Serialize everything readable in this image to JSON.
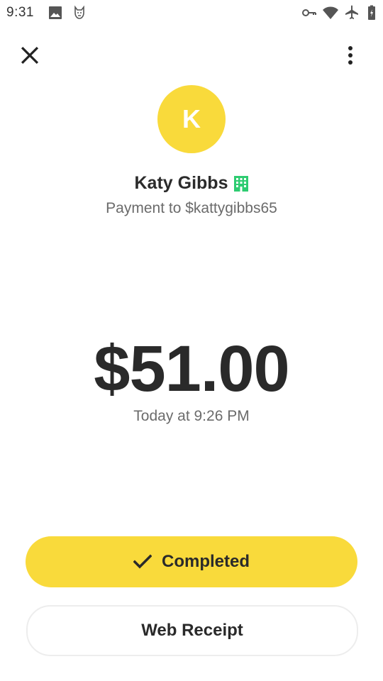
{
  "status_bar": {
    "time": "9:31",
    "icons": [
      "image-icon",
      "cat-icon",
      "key-icon",
      "wifi-icon",
      "airplane-icon",
      "battery-icon"
    ]
  },
  "top_bar": {
    "close_icon": "close-icon",
    "more_icon": "more-vertical-icon"
  },
  "recipient": {
    "initial": "K",
    "name": "Katy Gibbs",
    "badge_icon": "business-icon",
    "payment_to": "Payment to $kattygibbs65"
  },
  "payment": {
    "amount": "$51.00",
    "timestamp": "Today at 9:26 PM"
  },
  "actions": {
    "status_label": "Completed",
    "status_icon": "check-icon",
    "receipt_label": "Web Receipt"
  },
  "colors": {
    "accent": "#f9da3b",
    "business_badge": "#2ecc71"
  }
}
